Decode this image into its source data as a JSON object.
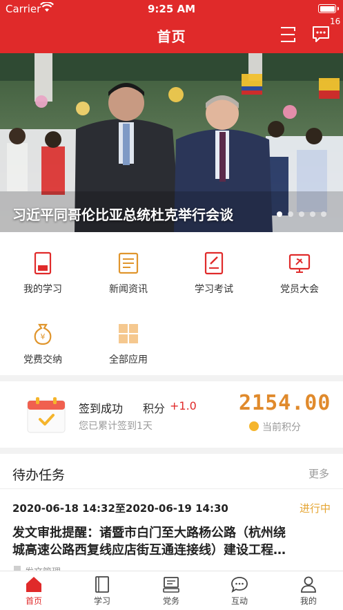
{
  "status_bar": {
    "carrier": "Carrier",
    "time": "9:25 AM"
  },
  "nav": {
    "title": "首页",
    "message_badge": "16"
  },
  "banner": {
    "caption": "习近平同哥伦比亚总统杜克举行会谈",
    "dots_total": 5,
    "active_dot": 1
  },
  "grid": {
    "items": [
      {
        "label": "我的学习",
        "icon": "my-study-icon"
      },
      {
        "label": "新闻资讯",
        "icon": "news-icon"
      },
      {
        "label": "学习考试",
        "icon": "exam-icon"
      },
      {
        "label": "党员大会",
        "icon": "party-meeting-icon"
      },
      {
        "label": "党费交纳",
        "icon": "party-fee-icon"
      },
      {
        "label": "全部应用",
        "icon": "all-apps-icon"
      }
    ]
  },
  "sign": {
    "title": "签到成功",
    "points_label": "积分",
    "points_increment": "+1.0",
    "subtitle": "您已累计签到1天",
    "total_points": "2154.00",
    "total_label": "当前积分"
  },
  "todo": {
    "header": "待办任务",
    "more": "更多",
    "item": {
      "date_range": "2020-06-18 14:32至2020-06-19 14:30",
      "status": "进行中",
      "line1": "发文审批提醒：诸暨市白门至大路杨公路（杭州绕",
      "line2": "城高速公路西复线应店街互通连接线）建设工程…",
      "category": "发文管理"
    }
  },
  "tabbar": {
    "tabs": [
      {
        "label": "首页",
        "icon": "home-icon",
        "active": true
      },
      {
        "label": "学习",
        "icon": "book-icon",
        "active": false
      },
      {
        "label": "党务",
        "icon": "party-affairs-icon",
        "active": false
      },
      {
        "label": "互动",
        "icon": "chat-icon",
        "active": false
      },
      {
        "label": "我的",
        "icon": "profile-icon",
        "active": false
      }
    ]
  },
  "colors": {
    "brand_red": "#e02a2a",
    "points_orange": "#e08a2c",
    "status_yellow": "#e5a533"
  }
}
